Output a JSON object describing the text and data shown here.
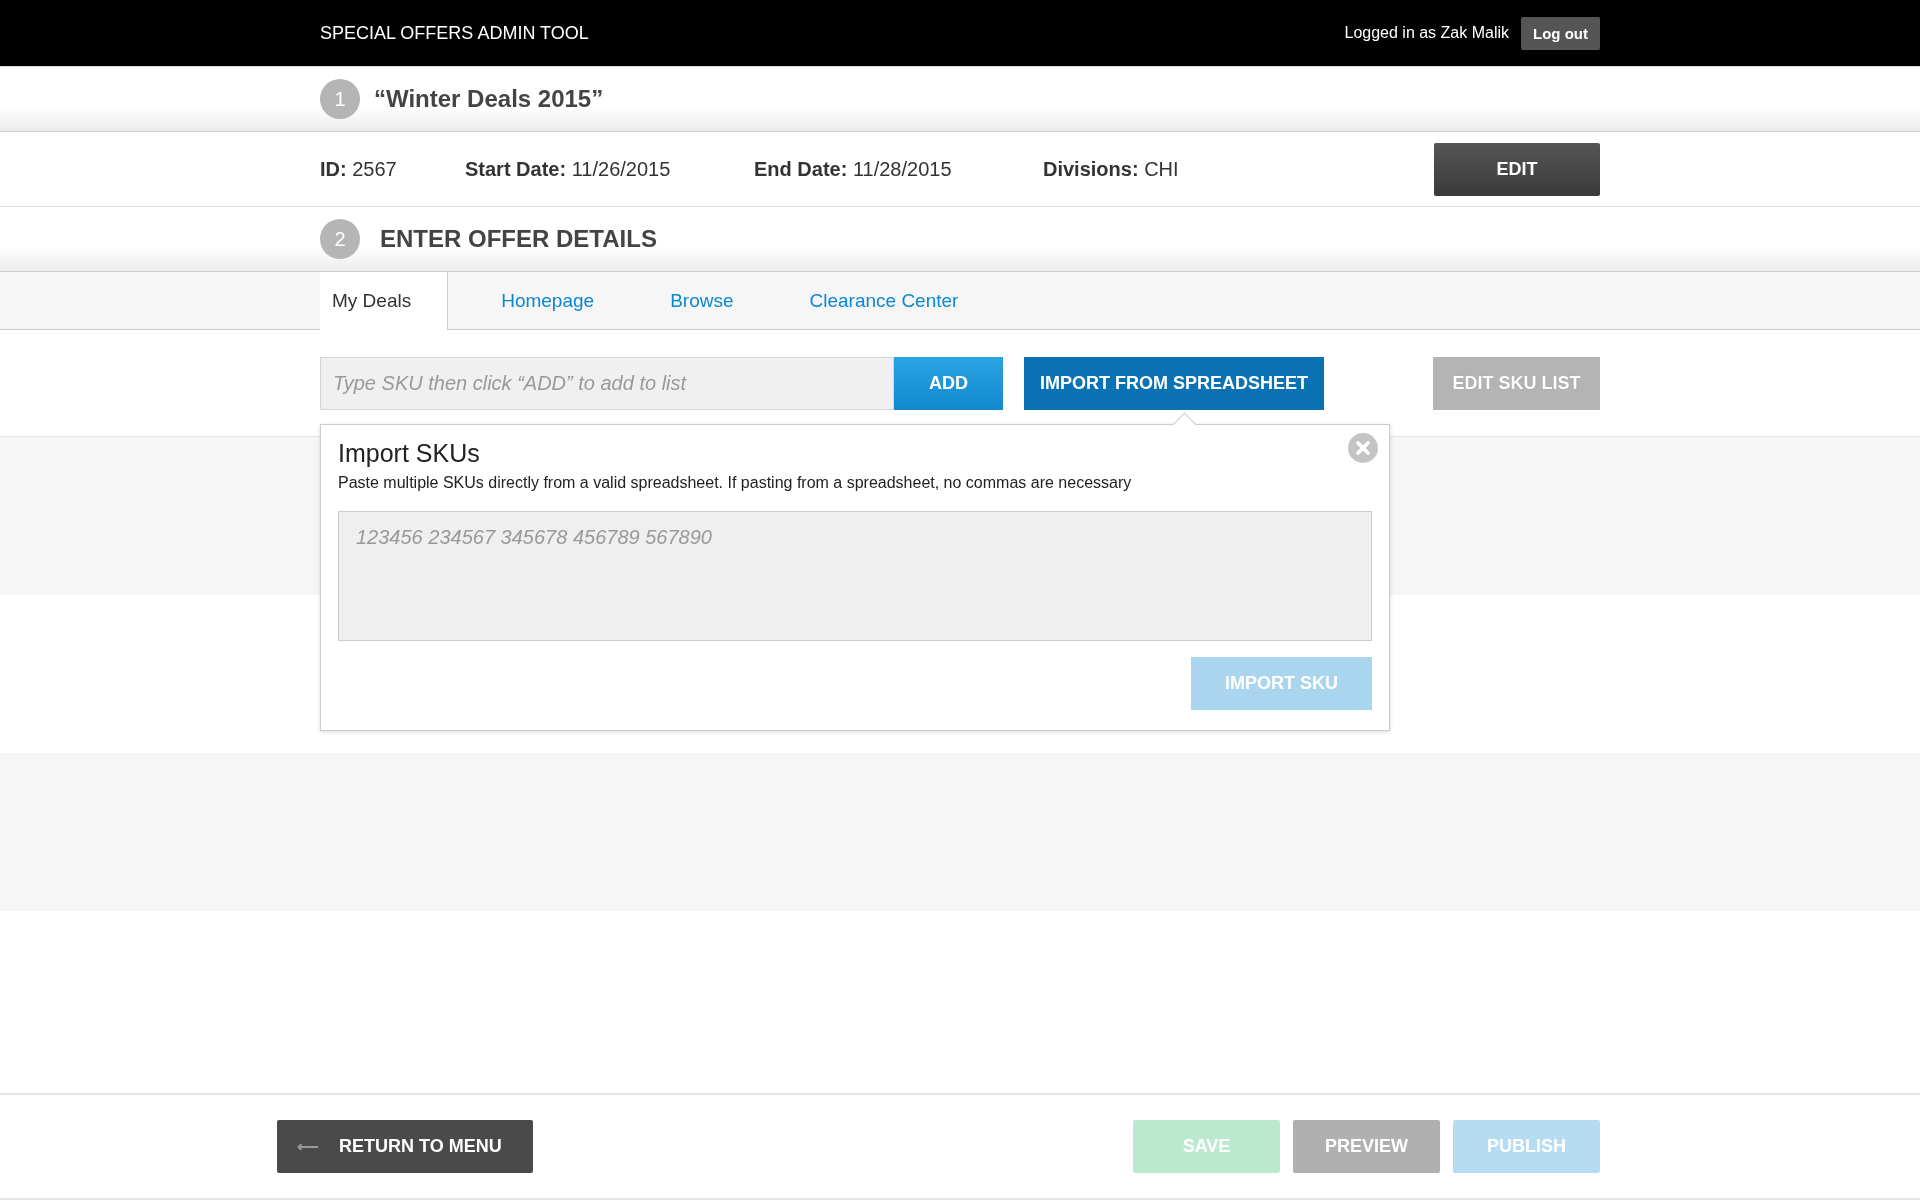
{
  "top_bar": {
    "title": "SPECIAL OFFERS ADMIN TOOL",
    "user_text": "Logged in as Zak Malik",
    "logout_button": "Log out"
  },
  "step_1": {
    "number": "1",
    "title": "“Winter Deals 2015”"
  },
  "offer_info": [
    {
      "label": "ID:",
      "value": "2567"
    },
    {
      "label": "Start Date:",
      "value": "11/26/2015"
    },
    {
      "label": "End Date:",
      "value": "11/28/2015"
    },
    {
      "label": "Divisions:",
      "value": "CHI"
    }
  ],
  "edit_button": "EDIT",
  "step_2": {
    "number": "2",
    "title": "ENTER OFFER DETAILS"
  },
  "tabs": [
    {
      "label": "My Deals",
      "selected": true
    },
    {
      "label": "Homepage",
      "selected": false
    },
    {
      "label": "Browse",
      "selected": false
    },
    {
      "label": "Clearance Center",
      "selected": false
    }
  ],
  "sku_field": {
    "placeholder": "Type SKU then click “ADD” to add to list"
  },
  "add_button": {
    "label": "ADD",
    "disabled": false
  },
  "import_button": {
    "label": "IMPORT FROM SPREADSHEET",
    "disabled": false
  },
  "edit_sku_list_button": {
    "label": "EDIT SKU LIST",
    "disabled": true
  },
  "import_popup": {
    "title": "Import SKUs",
    "description": "Paste multiple SKUs directly from a valid spreadsheet. If pasting from a spreadsheet, no commas are necessary",
    "textarea": {
      "placeholder": "123456 234567 345678 456789 567890"
    },
    "import_button": {
      "label": "IMPORT SKU",
      "disabled": true
    }
  },
  "footer": {
    "return_button": "RETURN TO MENU",
    "actions": [
      {
        "label": "SAVE",
        "kind": "success",
        "disabled": true
      },
      {
        "label": "PREVIEW",
        "kind": "neutral",
        "disabled": true
      },
      {
        "label": "PUBLISH",
        "kind": "primary",
        "disabled": true
      }
    ]
  }
}
